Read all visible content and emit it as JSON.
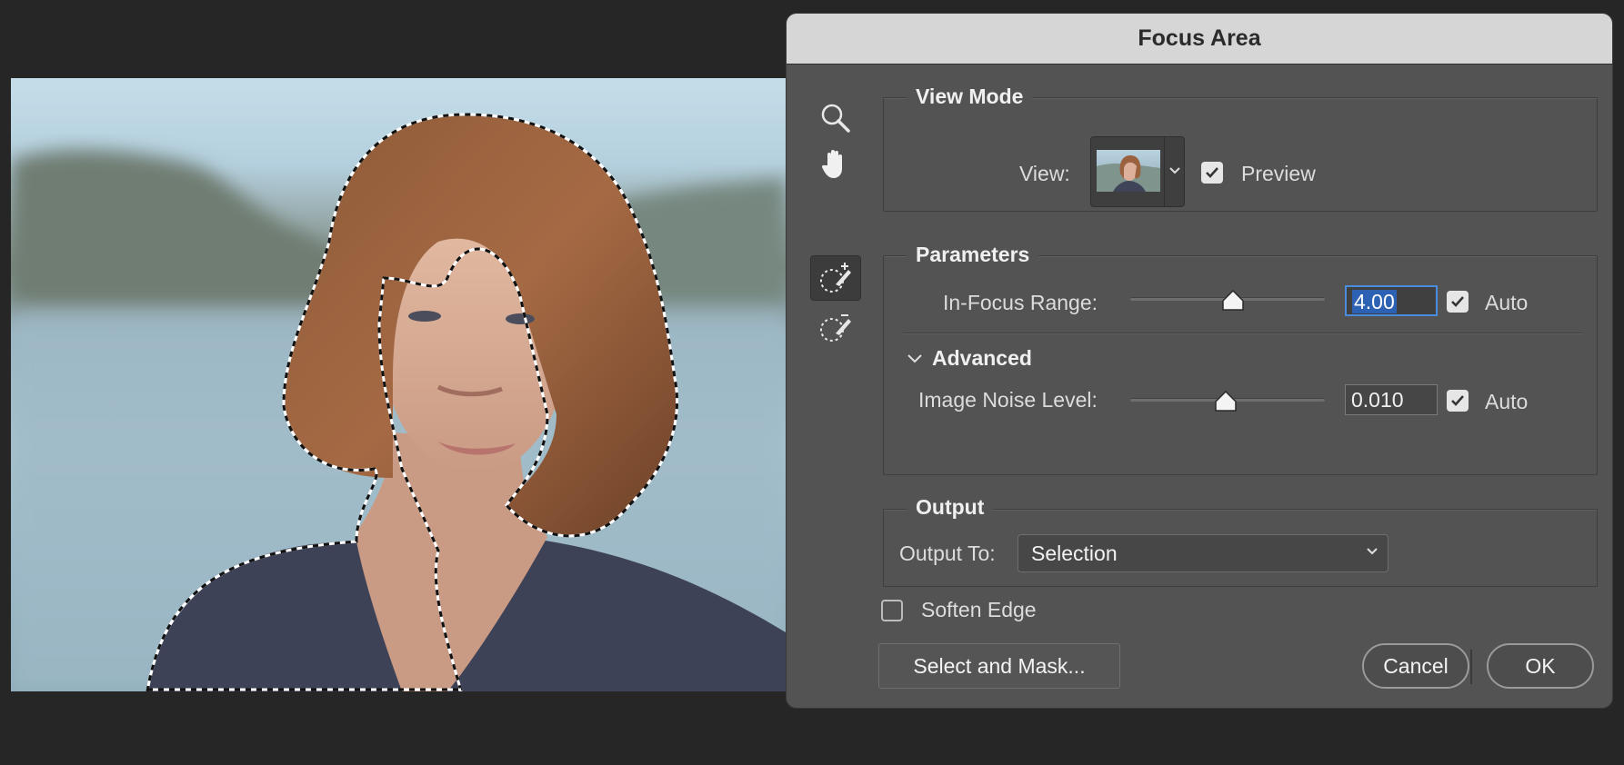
{
  "dialog": {
    "title": "Focus Area",
    "tools": [
      "zoom-tool",
      "hand-tool",
      "focus-area-add-tool",
      "focus-area-subtract-tool"
    ],
    "view_mode": {
      "title": "View Mode",
      "view_label": "View:",
      "preview_label": "Preview",
      "preview_checked": true
    },
    "parameters": {
      "title": "Parameters",
      "in_focus_range_label": "In-Focus Range:",
      "in_focus_range_value": "4.00",
      "in_focus_range_auto_label": "Auto",
      "in_focus_range_auto": true,
      "in_focus_slider_level": 0.53,
      "advanced_label": "Advanced",
      "noise_label": "Image Noise Level:",
      "noise_value": "0.010",
      "noise_auto_label": "Auto",
      "noise_auto": true,
      "noise_slider_level": 0.49
    },
    "output": {
      "title": "Output",
      "output_to_label": "Output To:",
      "output_to_value": "Selection"
    },
    "soften_edge_label": "Soften Edge",
    "soften_edge_checked": false,
    "buttons": {
      "select_and_mask": "Select and Mask...",
      "cancel": "Cancel",
      "ok": "OK"
    }
  },
  "colors": {
    "dialog_bg": "#535353",
    "titlebar_bg": "#d6d6d6",
    "focus_blue": "#4a8de0",
    "app_bg": "#262626"
  }
}
